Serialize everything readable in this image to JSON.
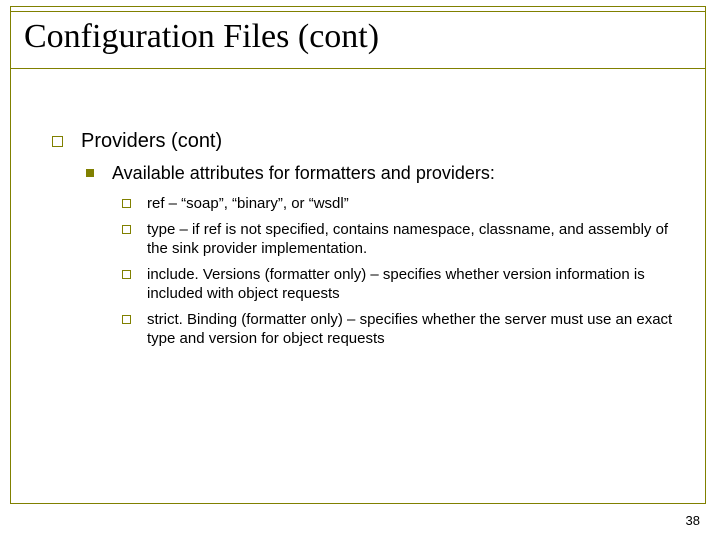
{
  "title": "Configuration Files (cont)",
  "lvl1": "Providers (cont)",
  "lvl2": "Available attributes for formatters and providers:",
  "items": [
    "ref – “soap”, “binary”, or “wsdl”",
    "type – if ref is not specified, contains namespace, classname, and assembly of the sink provider implementation.",
    "include. Versions (formatter only) – specifies whether version information is included with object requests",
    "strict. Binding (formatter only) – specifies whether the server must use an exact type and version for object requests"
  ],
  "page_number": "38"
}
